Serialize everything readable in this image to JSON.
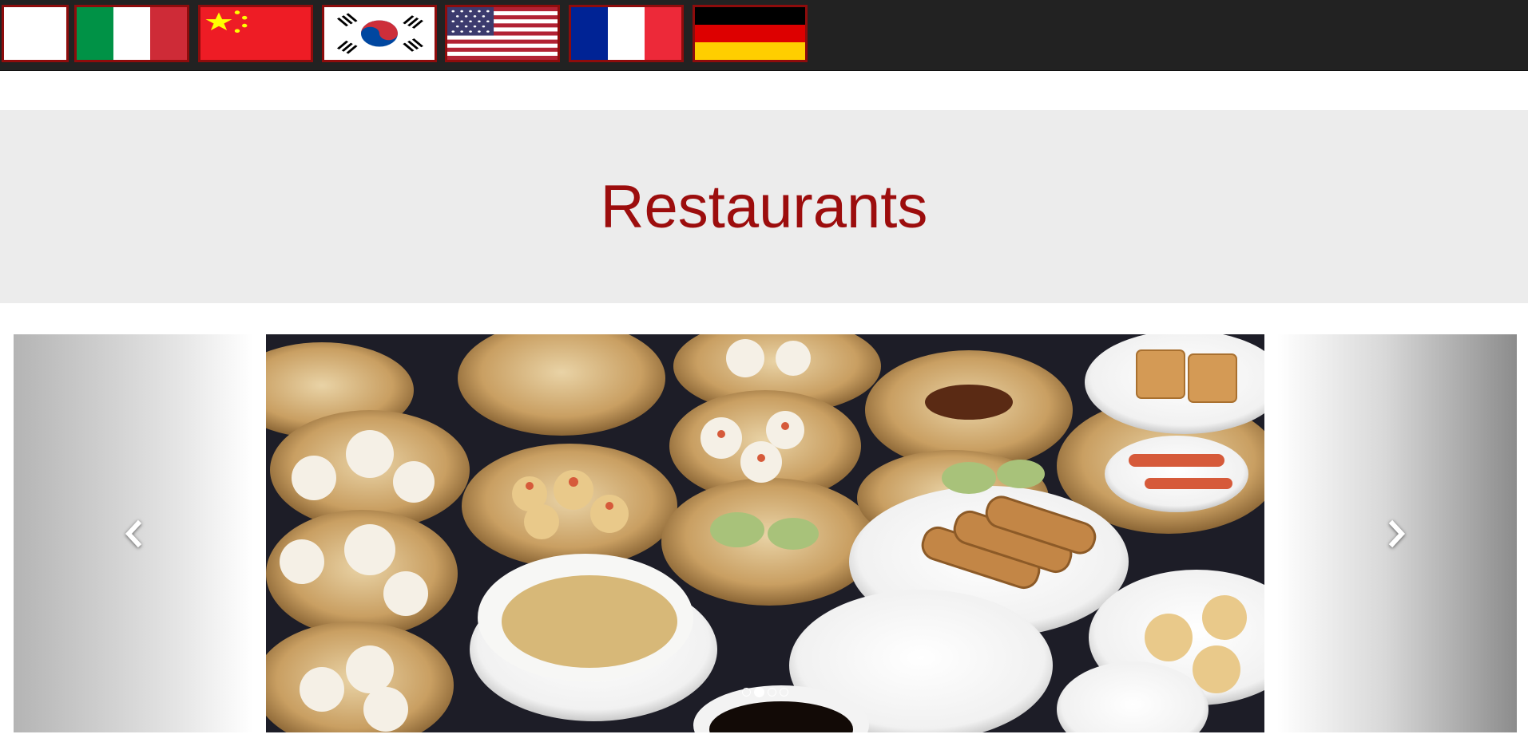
{
  "language_bar": {
    "flags": [
      {
        "name": "blank-flag",
        "label": ""
      },
      {
        "name": "italy-flag",
        "label": ""
      },
      {
        "name": "china-flag",
        "label": ""
      },
      {
        "name": "south-korea-flag",
        "label": ""
      },
      {
        "name": "usa-flag",
        "label": ""
      },
      {
        "name": "france-flag",
        "label": ""
      },
      {
        "name": "germany-flag",
        "label": ""
      }
    ]
  },
  "hero": {
    "title": "Restaurants"
  },
  "carousel": {
    "current_slide": 2,
    "slide_count": 4,
    "prev_icon": "chevron-left-icon",
    "next_icon": "chevron-right-icon"
  },
  "colors": {
    "topbar": "#222222",
    "flag_border": "#8e0c0c",
    "title": "#9c0d0d",
    "hero_background": "#ececec"
  }
}
